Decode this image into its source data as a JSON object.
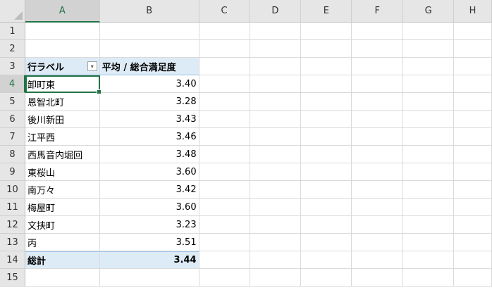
{
  "columns": [
    "A",
    "B",
    "C",
    "D",
    "E",
    "F",
    "G",
    "H"
  ],
  "row_numbers": [
    "1",
    "2",
    "3",
    "4",
    "5",
    "6",
    "7",
    "8",
    "9",
    "10",
    "11",
    "12",
    "13",
    "14",
    "15"
  ],
  "pivot": {
    "header_label": "行ラベル",
    "header_value": "平均 / 総合満足度",
    "filter_icon": "dropdown-filter-icon",
    "rows": [
      {
        "label": "卸町東",
        "value": "3.40"
      },
      {
        "label": "恩智北町",
        "value": "3.28"
      },
      {
        "label": "後川新田",
        "value": "3.43"
      },
      {
        "label": "江平西",
        "value": "3.46"
      },
      {
        "label": "西馬音内堀回",
        "value": "3.48"
      },
      {
        "label": "東桜山",
        "value": "3.60"
      },
      {
        "label": "南万々",
        "value": "3.42"
      },
      {
        "label": "梅屋町",
        "value": "3.60"
      },
      {
        "label": "文挟町",
        "value": "3.23"
      },
      {
        "label": "丙",
        "value": "3.51"
      }
    ],
    "total_label": "総計",
    "total_value": "3.44"
  },
  "active_cell": "A4",
  "colors": {
    "accent": "#217346",
    "pivot_fill": "#ddebf7"
  }
}
